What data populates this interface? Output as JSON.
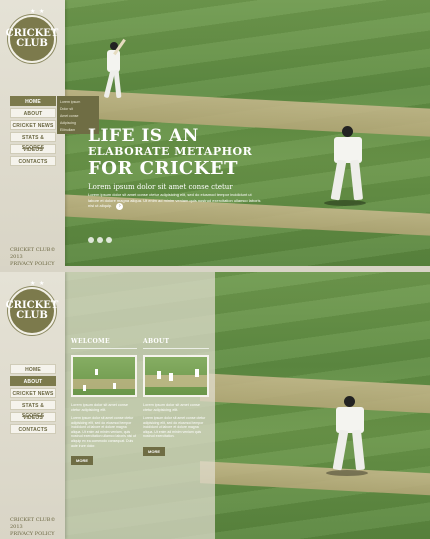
{
  "brand": {
    "stars": "★ ★",
    "line1": "CRICKET",
    "line2": "CLUB"
  },
  "nav": [
    {
      "label": "HOME"
    },
    {
      "label": "ABOUT"
    },
    {
      "label": "CRICKET NEWS"
    },
    {
      "label": "STATS & SCORES"
    },
    {
      "label": "VIDEOS"
    },
    {
      "label": "CONTACTS"
    }
  ],
  "dropdown": [
    "Lorem ipsum",
    "Dolor sit",
    "Amet conse",
    "Adipiscing",
    "Elitnullam"
  ],
  "hero": {
    "line1": "LIFE IS AN",
    "line2": "ELABORATE METAPHOR",
    "line3": "FOR CRICKET",
    "subtitle": "Lorem ipsum dolor sit amet conse ctetur",
    "body": "Lorem ipsum dolor sit amet conse ctetur adipisicing elit, sed do eiusmod tempor incididunt ut labore et dolore magna aliqua. Ut enim ad minim veniam quis nostrud exercitation ullamco laboris nisi ut aliquip.",
    "more_glyph": "›"
  },
  "footer": {
    "line1": "CRICKET CLUB© 2013",
    "line2": "PRIVACY POLICY"
  },
  "welcome": {
    "title": "WELCOME",
    "lead": "Lorem ipsum dolor sit amet conse ctetur adipisicing elit.",
    "body": "Lorem ipsum dolor sit amet conse ctetur adipisicing elit, sed do eiusmod tempor incididunt ut labore et dolore magna aliqua. Ut enim ad minim veniam, quis nostrud exercitation ullamco laboris nisi ut aliquip ex ea commodo consequat. Duis aute irure dolor.",
    "button": "MORE"
  },
  "about": {
    "title": "ABOUT",
    "lead": "Lorem ipsum dolor sit amet conse ctetur adipisicing elit.",
    "body": "Lorem ipsum dolor sit amet conse ctetur adipisicing elit, sed do eiusmod tempor incididunt ut labore et dolore magna aliqua. Ut enim ad minim veniam quis nostrud exercitation.",
    "button": "MORE"
  }
}
